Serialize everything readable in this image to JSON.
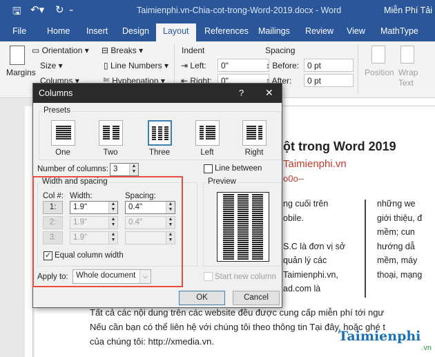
{
  "titlebar": {
    "title": "Taimienphi.vn-Chia-cot-trong-Word-2019.docx  -  Word",
    "user": "Miễn Phí Tải"
  },
  "tabs": [
    "File",
    "Home",
    "Insert",
    "Design",
    "Layout",
    "References",
    "Mailings",
    "Review",
    "View",
    "MathType"
  ],
  "active_tab": "Layout",
  "ribbon": {
    "margins": "Margins",
    "orientation": "Orientation",
    "size": "Size",
    "columns": "Columns",
    "breaks": "Breaks",
    "line_numbers": "Line Numbers",
    "hyphenation": "Hyphenation",
    "indent": "Indent",
    "left": "Left:",
    "right": "Right:",
    "left_value": "0\"",
    "right_value": "0\"",
    "spacing": "Spacing",
    "before": "Before:",
    "after": "After:",
    "before_value": "0 pt",
    "after_value": "0 pt",
    "position": "Position",
    "wrap": "Wrap",
    "text": "Text"
  },
  "dialog": {
    "title": "Columns",
    "help": "?",
    "close": "✕",
    "presets_label": "Presets",
    "presets": [
      {
        "label": "One",
        "key": "O"
      },
      {
        "label": "Two",
        "key": "w"
      },
      {
        "label": "Three",
        "key": "T"
      },
      {
        "label": "Left",
        "key": "L"
      },
      {
        "label": "Right",
        "key": "R"
      }
    ],
    "selected_preset": "Three",
    "number_of_columns_label": "Number of columns:",
    "number_of_columns": "3",
    "line_between_label": "Line between",
    "line_between": false,
    "width_spacing_label": "Width and spacing",
    "col_label": "Col #:",
    "width_label": "Width:",
    "spacing_label": "Spacing:",
    "rows": [
      {
        "col": "1:",
        "width": "1.9\"",
        "spacing": "0.4\""
      },
      {
        "col": "2:",
        "width": "1.9\"",
        "spacing": "0.4\""
      },
      {
        "col": "3:",
        "width": "1.9\"",
        "spacing": ""
      }
    ],
    "equal_width_label": "Equal column width",
    "equal_width": true,
    "apply_to_label": "Apply to:",
    "apply_to": "Whole document",
    "preview_label": "Preview",
    "start_new_column_label": "Start new column",
    "ok": "OK",
    "cancel": "Cancel",
    "highlight_color": "#e74c3c"
  },
  "document": {
    "heading": "ột trong Word 2019",
    "sub1": "Taimienphi.vn",
    "sub2": "o0o--",
    "col1": [
      "ng cuối trên",
      "obile.",
      "",
      "S.C là đơn vị sở",
      "quản lý các",
      "Taimienphi.vn,",
      "ad.com         là"
    ],
    "col2": [
      "những  we",
      "giới thiệu, đ",
      "mềm;   cun",
      "hướng  dẫ",
      "mềm,  máy",
      "thoại, mạng"
    ],
    "body": [
      "Tất cả các nội dung trên các website đều được cung cấp miễn phí tới ngư",
      "Nếu cần bạn có thể liên hệ với chúng tôi theo thông tin Tại đây, hoặc ghé t",
      "của chúng tôi: http://xmedia.vn."
    ],
    "watermark": "Taimienphi.vn"
  }
}
